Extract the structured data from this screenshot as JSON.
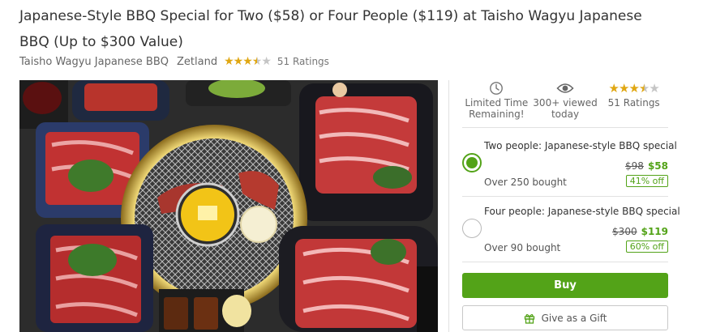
{
  "deal": {
    "title": "Japanese-Style BBQ Special for Two ($58) or Four People ($119) at Taisho Wagyu Japanese BBQ (Up to $300 Value)",
    "merchant": "Taisho Wagyu Japanese BBQ",
    "location": "Zetland",
    "rating": 3.5,
    "rating_label": "51 Ratings"
  },
  "hero_image": {
    "icon": "bbq-food-photo"
  },
  "features": [
    {
      "icon": "clock-icon",
      "label": "Limited Time Remaining!"
    },
    {
      "icon": "eye-icon",
      "label": "300+ viewed today"
    },
    {
      "icon": "star-rating",
      "label": "51 Ratings"
    }
  ],
  "options": [
    {
      "title": "Two people: Japanese-style BBQ special",
      "original_price": "$98",
      "price": "$58",
      "bought": "Over 250 bought",
      "discount": "41% off",
      "selected": true
    },
    {
      "title": "Four people: Japanese-style BBQ special",
      "original_price": "$300",
      "price": "$119",
      "bought": "Over 90 bought",
      "discount": "60% off",
      "selected": false
    }
  ],
  "actions": {
    "buy_label": "Buy",
    "gift_label": "Give as a Gift",
    "gift_icon": "gift-icon"
  },
  "colors": {
    "accent": "#53a318",
    "star": "#e0a712"
  }
}
